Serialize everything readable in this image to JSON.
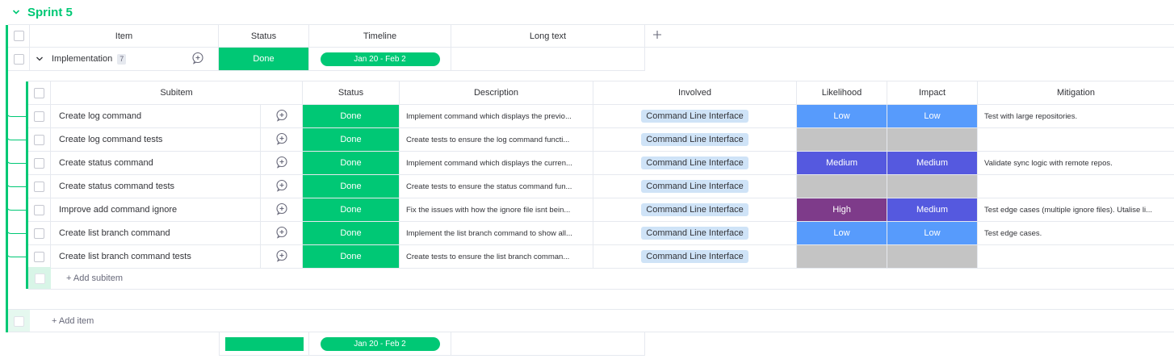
{
  "group": {
    "title": "Sprint 5",
    "columns": [
      "Item",
      "Status",
      "Timeline",
      "Long text"
    ],
    "item": {
      "name": "Implementation",
      "count": "7",
      "status": "Done",
      "timeline": "Jan 20 - Feb 2"
    },
    "add_item_label": "+ Add item",
    "summary": {
      "timeline": "Jan 20 - Feb 2"
    }
  },
  "subtable": {
    "columns": [
      "Subitem",
      "Status",
      "Description",
      "Involved",
      "Likelihood",
      "Impact",
      "Mitigation"
    ],
    "rows": [
      {
        "name": "Create log command",
        "status": "Done",
        "description": "Implement command which displays the previo...",
        "involved": "Command Line Interface",
        "likelihood": "Low",
        "impact": "Low",
        "mitigation": "Test with large repositories."
      },
      {
        "name": "Create log command tests",
        "status": "Done",
        "description": "Create tests to ensure the log command functi...",
        "involved": "Command Line Interface",
        "likelihood": "",
        "impact": "",
        "mitigation": ""
      },
      {
        "name": "Create status command",
        "status": "Done",
        "description": "Implement command which displays the curren...",
        "involved": "Command Line Interface",
        "likelihood": "Medium",
        "impact": "Medium",
        "mitigation": "Validate sync logic with remote repos."
      },
      {
        "name": "Create status command tests",
        "status": "Done",
        "description": "Create tests to ensure the status command fun...",
        "involved": "Command Line Interface",
        "likelihood": "",
        "impact": "",
        "mitigation": ""
      },
      {
        "name": "Improve add command ignore",
        "status": "Done",
        "description": "Fix the issues with how the ignore file isnt bein...",
        "involved": "Command Line Interface",
        "likelihood": "High",
        "impact": "Medium",
        "mitigation": "Test edge cases (multiple ignore files). Utalise li..."
      },
      {
        "name": "Create list branch command",
        "status": "Done",
        "description": "Implement the list branch command to show all...",
        "involved": "Command Line Interface",
        "likelihood": "Low",
        "impact": "Low",
        "mitigation": "Test edge cases."
      },
      {
        "name": "Create list branch command tests",
        "status": "Done",
        "description": "Create tests to ensure the list branch comman...",
        "involved": "Command Line Interface",
        "likelihood": "",
        "impact": "",
        "mitigation": ""
      }
    ],
    "add_subitem_label": "+ Add subitem"
  },
  "colors": {
    "done": "#00c875",
    "low": "#579bfc",
    "medium": "#5559df",
    "high": "#7e3b8a",
    "empty": "#c4c4c4"
  }
}
